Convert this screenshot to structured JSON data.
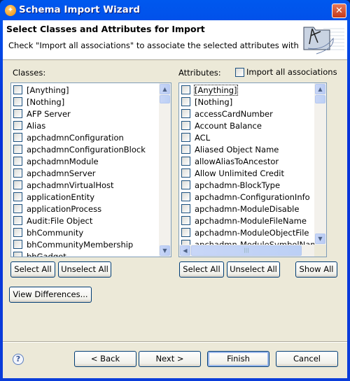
{
  "window": {
    "title": "Schema Import Wizard"
  },
  "header": {
    "title": "Select Classes and Attributes for Import",
    "description": "Check \"Import all associations\" to associate the selected attributes with"
  },
  "classes": {
    "label": "Classes:",
    "items": [
      "[Anything]",
      "[Nothing]",
      "AFP Server",
      "Alias",
      "apchadmnConfiguration",
      "apchadmnConfigurationBlock",
      "apchadmnModule",
      "apchadmnServer",
      "apchadmnVirtualHost",
      "applicationEntity",
      "applicationProcess",
      "Audit:File Object",
      "bhCommunity",
      "bhCommunityMembership",
      "bhGadget"
    ],
    "select_all": "Select All",
    "unselect_all": "Unselect All"
  },
  "attributes": {
    "label": "Attributes:",
    "import_all_label": "Import all associations",
    "import_all_checked": false,
    "items": [
      "[Anything]",
      "[Nothing]",
      "accessCardNumber",
      "Account Balance",
      "ACL",
      "Aliased Object Name",
      "allowAliasToAncestor",
      "Allow Unlimited Credit",
      "apchadmn-BlockType",
      "apchadmn-ConfigurationInfo",
      "apchadmn-ModuleDisable",
      "apchadmn-ModuleFileName",
      "apchadmn-ModuleObjectFile",
      "apchadmn-ModuleSymbolName"
    ],
    "select_all": "Select All",
    "unselect_all": "Unselect All",
    "show_all": "Show All"
  },
  "view_differences": "View Differences...",
  "footer": {
    "back": "< Back",
    "next": "Next >",
    "finish": "Finish",
    "cancel": "Cancel"
  }
}
